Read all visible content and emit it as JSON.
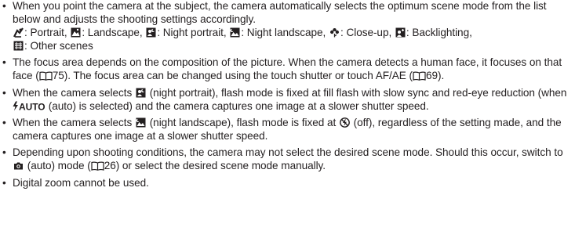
{
  "item1": {
    "text": "When you point the camera at the subject, the camera automatically selects the optimum scene mode from the list below and adjusts the shooting settings accordingly.",
    "scenes": [
      {
        "icon": "portrait-icon",
        "label": ": Portrait, "
      },
      {
        "icon": "landscape-icon",
        "label": ": Landscape, "
      },
      {
        "icon": "night-portrait-icon",
        "label": ": Night portrait, "
      },
      {
        "icon": "night-landscape-icon",
        "label": ": Night landscape, "
      },
      {
        "icon": "close-up-icon",
        "label": ": Close-up, "
      },
      {
        "icon": "backlighting-icon",
        "label": ": Backlighting,"
      },
      {
        "icon": "other-scenes-icon",
        "label": ": Other scenes"
      }
    ]
  },
  "item2": {
    "part1": "The focus area depends on the composition of the picture. When the camera detects a human face, it focuses on that face (",
    "ref1": "75",
    "part2": "). The focus area can be changed using the touch shutter or touch AF/AE (",
    "ref2": "69",
    "part3": ")."
  },
  "item3": {
    "part1": "When the camera selects",
    "part2": "(night portrait), flash mode is fixed at fill flash with slow sync and red-eye reduction (when",
    "part3": "(auto) is selected) and the camera captures one image at a slower shutter speed."
  },
  "item4": {
    "part1": "When the camera selects",
    "part2": "(night landscape), flash mode is fixed at",
    "part3": "(off), regardless of the setting made, and the camera captures one image at a slower shutter speed."
  },
  "item5": {
    "part1": "Depending upon shooting conditions, the camera may not select the desired scene mode. Should this occur, switch to",
    "part2": "(auto) mode (",
    "ref": "26",
    "part3": ") or select the desired scene mode manually."
  },
  "item6": {
    "text": "Digital zoom cannot be used."
  },
  "icons": {
    "auto_flash_text": "AUTO"
  }
}
